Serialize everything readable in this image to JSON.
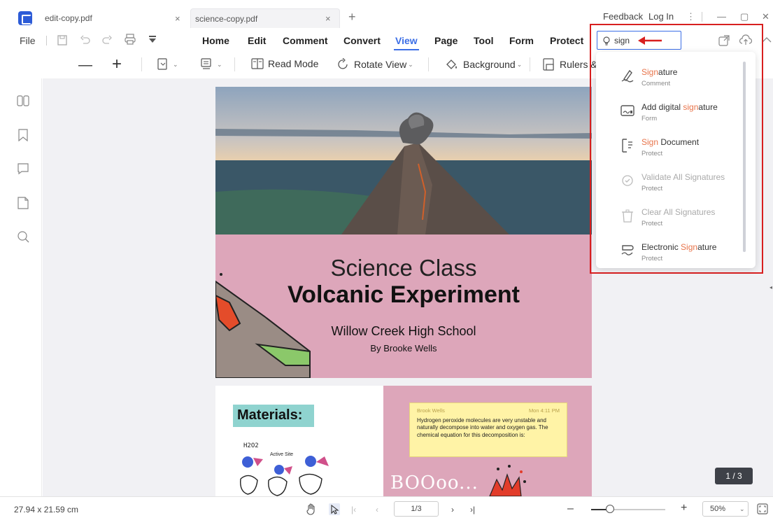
{
  "tabs": [
    {
      "label": "edit-copy.pdf",
      "close": "×"
    },
    {
      "label": "science-copy.pdf",
      "close": "×"
    }
  ],
  "new_tab": "+",
  "titlebar_right": {
    "feedback": "Feedback",
    "login": "Log In",
    "more": "⋮",
    "minimize": "—",
    "maximize": "▢",
    "close": "✕"
  },
  "menu": {
    "file": "File",
    "items": [
      "Home",
      "Edit",
      "Comment",
      "Convert",
      "View",
      "Page",
      "Tool",
      "Form",
      "Protect"
    ],
    "active": "View"
  },
  "search": {
    "value": "sign"
  },
  "toolbar": {
    "zoom_out": "—",
    "zoom_in": "+",
    "read_mode": "Read Mode",
    "rotate_view": "Rotate View",
    "background": "Background",
    "rulers": "Rulers &"
  },
  "dropdown": {
    "items": [
      {
        "pre": "",
        "hl": "Sign",
        "post": "ature",
        "sub": "Comment",
        "icon": "signature-pen-icon",
        "disabled": false
      },
      {
        "pre": "Add digital ",
        "hl": "sign",
        "post": "ature",
        "sub": "Form",
        "icon": "digital-signature-icon",
        "disabled": false
      },
      {
        "pre": "",
        "hl": "Sign",
        "post": " Document",
        "sub": "Protect",
        "icon": "sign-document-icon",
        "disabled": false
      },
      {
        "pre": "Validate All Signatures",
        "hl": "",
        "post": "",
        "sub": "Protect",
        "icon": "validate-signature-icon",
        "disabled": true
      },
      {
        "pre": "Clear All Signatures",
        "hl": "",
        "post": "",
        "sub": "Protect",
        "icon": "trash-icon",
        "disabled": true
      },
      {
        "pre": "Electronic ",
        "hl": "Sign",
        "post": "ature",
        "sub": "Protect",
        "icon": "electronic-signature-icon",
        "disabled": false
      }
    ]
  },
  "document": {
    "title_line1": "Science Class",
    "title_line2": "Volcanic Experiment",
    "school": "Willow Creek High School",
    "author": "By Brooke Wells",
    "materials": "Materials:",
    "note_author": "Brook Wells",
    "note_time": "Mon 4:11 PM",
    "note_text": "Hydrogen peroxide molecules are very unstable and naturally decompose into water and oxygen gas. The chemical equation for this decomposition is:",
    "handwriting_1": "H2O2",
    "handwriting_2": "Active Site",
    "boom_text": "BOOoo..."
  },
  "status": {
    "page_size": "27.94 x 21.59 cm",
    "page_field": "1/3",
    "zoom": "50%",
    "page_indicator": "1 / 3",
    "zoom_level": 0.25
  },
  "colors": {
    "accent": "#3b6ee6",
    "highlight": "#e8744b",
    "callout": "#d81f1f",
    "page_pink": "#dda6ba"
  }
}
